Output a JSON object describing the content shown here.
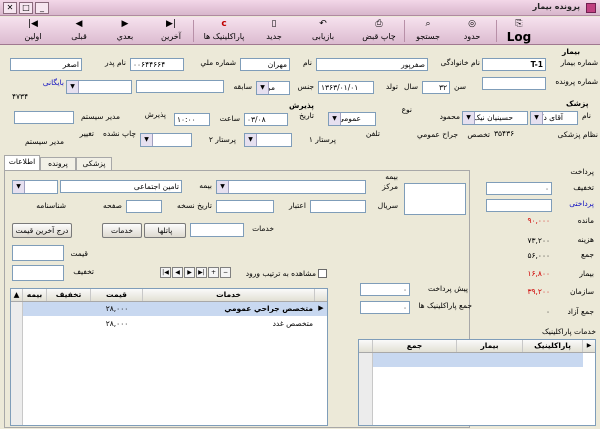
{
  "window": {
    "title": "پرونده بیمار"
  },
  "toolbar": {
    "log": "Log",
    "hodood": "حدود",
    "jostojoo": "جستجو",
    "chap_ghabz": "چاپ قبض",
    "bazyabi": "بازیابی",
    "jadid": "جدید",
    "paraclinic": "پاراکلینیک ها",
    "akharin": "آخرین",
    "badi": "بعدي",
    "ghabli": "قبلی",
    "avalin": "اولین"
  },
  "patient": {
    "section_label": "بیمار",
    "patient_no_label": "شماره بیمار",
    "patient_no": "T-1",
    "last_name_label": "نام خانوادگی",
    "last_name": "صفرپور",
    "first_name_label": "نام",
    "first_name": "مهران",
    "national_id_label": "شماره ملي",
    "national_id": "۰۰۶۴۴۶۶۴",
    "father_label": "نام پدر",
    "father": "اصغر",
    "file_no_label": "شماره پرونده",
    "age_label": "سن",
    "age": "۳۲",
    "year_label": "سال",
    "birth_label": "تولد",
    "birth_date": "۱۳۶۳/۰۱/۰۱",
    "gender_label": "جنس",
    "gender": "مرد",
    "history_label": "سابقه",
    "archive_label": "بایگانی",
    "archive_no": "۴۷۳۴"
  },
  "doctor": {
    "section_label": "پزشک",
    "name_label": "نام",
    "title": "آقای دکتر",
    "name": "حسینیان نیک",
    "first_name": "محمود",
    "type_label": "نوع",
    "type": "عمومی",
    "med_no_label": "نظام پزشکی",
    "med_no": "۳۵۴۳۶",
    "specialty_label": "تخصص",
    "specialty": "جراح عمومي",
    "phone_label": "تلفن"
  },
  "admission": {
    "section_label": "پذیرش",
    "date_label": "تاریخ",
    "date": "۰۳/۰۸",
    "time_label": "ساعت",
    "time": "۱۰:۰۰",
    "admit_label": "پذیرش",
    "admit_user": "مدیر سیستم",
    "nurse1_label": "پرستار ۱",
    "nurse2_label": "پرستار ۲",
    "printed_label": "چاپ نشده",
    "change_label": "تغییر",
    "change_user": "مدیر سیستم"
  },
  "tabs": [
    "اطلاعات",
    "پرونده",
    "پزشکی"
  ],
  "insurance": {
    "section_label": "بیمه",
    "center_label": "مرکز",
    "insurance_label": "بیمه",
    "insurance_value": "تامین اجتماعی",
    "serial_label": "سریال",
    "credit_label": "اعتبار",
    "rx_date_label": "تاریخ نسخه",
    "page_label": "صفحه",
    "id_card_label": "شناسنامه"
  },
  "services": {
    "label": "خدمات",
    "packages_btn": "پاتلها",
    "services_btn": "خدمات",
    "last_price_btn": "درج آخرین قیمت",
    "price_label": "قیمت",
    "discount_label": "تخفیف",
    "order_label": "مشاهده به ترتیب ورود",
    "columns": [
      "خدمات",
      "قیمت",
      "تخفیف",
      "بیمه"
    ],
    "rows": [
      {
        "service": "متخصص جراحي عمومي",
        "price": "۲۸,۰۰۰",
        "discount": "",
        "insurance": ""
      },
      {
        "service": "متخصص غدد",
        "price": "۲۸,۰۰۰",
        "discount": "",
        "insurance": ""
      }
    ]
  },
  "payment": {
    "section_label": "پرداخت",
    "discount_label": "تخفیف",
    "discount": "۰",
    "pay_label": "پرداختی",
    "remain_label": "مانده",
    "remain": "۹۰,۰۰۰",
    "cost_label": "هزینه",
    "cost": "۷۳,۲۰۰",
    "total_label": "جمع",
    "total": "۵۶,۰۰۰",
    "patient_label": "بیمار",
    "patient": "۱۶,۸۰۰",
    "org_label": "سازمان",
    "org": "۳۹,۲۰۰",
    "free_label": "جمع آزاد",
    "free": "۰",
    "prepay_label": "پیش پرداخت",
    "prepay": "۰",
    "para_total_label": "جمع پاراکلینیک ها",
    "para_total": "۰"
  },
  "paraclinic": {
    "label": "خدمات پاراکلینیک",
    "columns": [
      "پاراکلینیک",
      "بیمار",
      "جمع"
    ]
  },
  "colors": {
    "titlebar": "#e6c8da",
    "toolbar": "#e9cfe0",
    "red_value": "#d00000",
    "blue_value": "#1010c0"
  }
}
